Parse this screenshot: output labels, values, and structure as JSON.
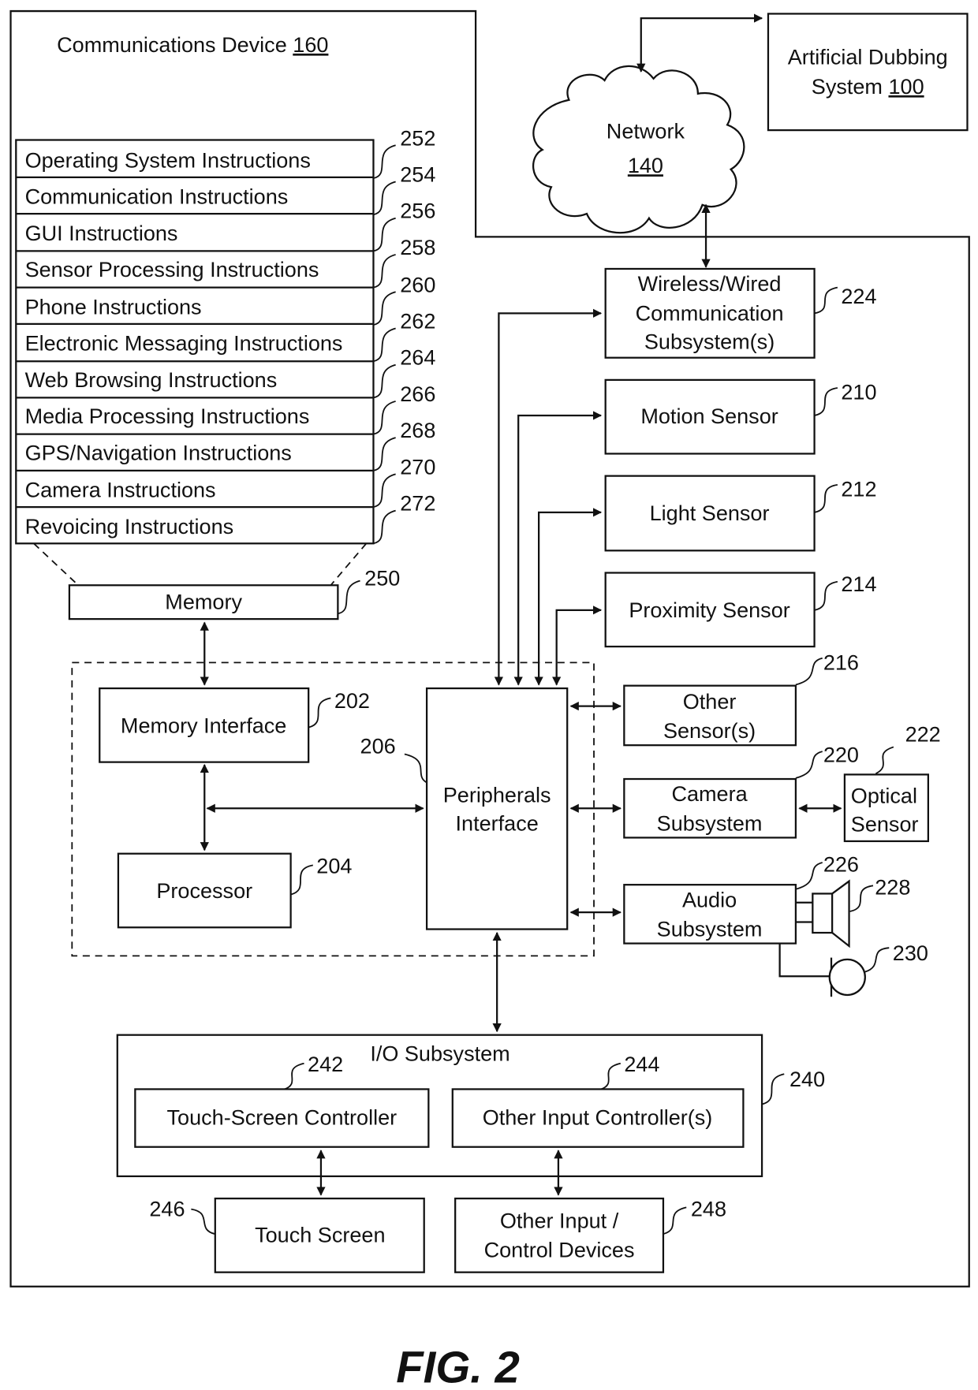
{
  "device": {
    "title": "Communications Device ",
    "ref": "160"
  },
  "dubbing": {
    "line1": "Artificial Dubbing",
    "line2": "System ",
    "ref": "100"
  },
  "network": {
    "label": "Network",
    "ref": "140"
  },
  "instructions": [
    {
      "label": "Operating System Instructions",
      "ref": "252"
    },
    {
      "label": "Communication Instructions",
      "ref": "254"
    },
    {
      "label": "GUI Instructions",
      "ref": "256"
    },
    {
      "label": "Sensor Processing Instructions",
      "ref": "258"
    },
    {
      "label": "Phone Instructions",
      "ref": "260"
    },
    {
      "label": "Electronic Messaging Instructions",
      "ref": "262"
    },
    {
      "label": "Web Browsing Instructions",
      "ref": "264"
    },
    {
      "label": "Media Processing Instructions",
      "ref": "266"
    },
    {
      "label": "GPS/Navigation Instructions",
      "ref": "268"
    },
    {
      "label": "Camera Instructions",
      "ref": "270"
    },
    {
      "label": "Revoicing Instructions",
      "ref": "272"
    }
  ],
  "memory": {
    "label": "Memory",
    "ref": "250"
  },
  "memory_interface": {
    "label": "Memory Interface",
    "ref": "202"
  },
  "processor": {
    "label": "Processor",
    "ref": "204"
  },
  "peripherals": {
    "line1": "Peripherals",
    "line2": "Interface",
    "ref": "206"
  },
  "wireless": {
    "line1": "Wireless/Wired",
    "line2": "Communication",
    "line3": "Subsystem(s)",
    "ref": "224"
  },
  "motion": {
    "label": "Motion Sensor",
    "ref": "210"
  },
  "light": {
    "label": "Light Sensor",
    "ref": "212"
  },
  "proximity": {
    "label": "Proximity Sensor",
    "ref": "214"
  },
  "other_sensors": {
    "line1": "Other",
    "line2": "Sensor(s)",
    "ref": "216"
  },
  "camera": {
    "line1": "Camera",
    "line2": "Subsystem",
    "ref": "220"
  },
  "optical": {
    "line1": "Optical",
    "line2": "Sensor",
    "ref": "222"
  },
  "audio": {
    "line1": "Audio",
    "line2": "Subsystem",
    "ref": "226"
  },
  "speaker": {
    "ref": "228"
  },
  "microphone": {
    "ref": "230"
  },
  "io": {
    "label": "I/O Subsystem",
    "ref": "240"
  },
  "touch_controller": {
    "label": "Touch-Screen Controller",
    "ref": "242"
  },
  "other_input_controller": {
    "label": "Other Input Controller(s)",
    "ref": "244"
  },
  "touch_screen": {
    "label": "Touch Screen",
    "ref": "246"
  },
  "other_input_devices": {
    "line1": "Other Input /",
    "line2": "Control Devices",
    "ref": "248"
  },
  "figure": {
    "caption": "FIG. 2"
  }
}
